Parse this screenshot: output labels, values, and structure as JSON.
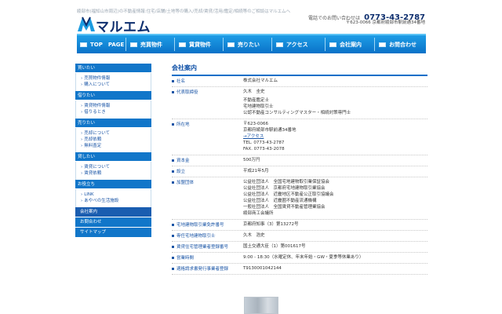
{
  "header": {
    "tagline": "綾部市(福知山市周辺)の不動産情報:住宅/店舗/土地等の購入/売却/賃貸/活用/鑑定/相続等のご相談はマルエムへ",
    "logo_text": "マルエム",
    "contact_label": "電話でのお問い合わせは",
    "phone": "0773-43-2787",
    "address": "〒623-0066 京都府綾部市駅前通34番地"
  },
  "global_nav": [
    {
      "label": "TOP　PAGE"
    },
    {
      "label": "売買物件"
    },
    {
      "label": "賃貸物件"
    },
    {
      "label": "売りたい"
    },
    {
      "label": "アクセス"
    },
    {
      "label": "会社案内"
    },
    {
      "label": "お問合わせ"
    }
  ],
  "side_nav": {
    "buy": {
      "title": "買いたい",
      "links": [
        "売買物件情報",
        "購入について"
      ]
    },
    "borrow": {
      "title": "借りたい",
      "links": [
        "賃貸物件情報",
        "借りるとき"
      ]
    },
    "sell": {
      "title": "売りたい",
      "links": [
        "売却について",
        "売却依頼",
        "無料査定"
      ]
    },
    "lend": {
      "title": "貸したい",
      "links": [
        "賃貸について",
        "賃貸依頼"
      ]
    },
    "useful": {
      "title": "お役立ち",
      "links": [
        "LINK",
        "あやべの生活施設"
      ]
    },
    "company": "会社案内",
    "contact": "お問合わせ",
    "sitemap": "サイトマップ"
  },
  "main": {
    "title": "会社案内",
    "rows": [
      {
        "key": "社名",
        "lines": [
          "株式会社マルエム"
        ]
      },
      {
        "key": "代表取締役",
        "lines": [
          "久木　圭史",
          "不動産鑑定士",
          "宅地建物取引士",
          "公認不動産コンサルティングマスター・相続対策専門士"
        ]
      },
      {
        "key": "所在地",
        "lines": [
          "〒623-0066",
          "京都府綾部市駅前通34番地",
          "→アクセス",
          "TEL. 0773-43-2787",
          "FAX. 0773-43-2078"
        ]
      },
      {
        "key": "資本金",
        "lines": [
          "500万円"
        ]
      },
      {
        "key": "設立",
        "lines": [
          "平成21年5月"
        ]
      },
      {
        "key": "加盟団体",
        "lines": [
          "公益社団法人　全国宅地建物取引業保証協会",
          "公益社団法人　京都府宅地建物取引業協会",
          "公益社団法人　近畿地区不動産公正取引協議会",
          "公益社団法人　近畿圏不動産流通機構",
          "一般社団法人　全国賃貸不動産管理業協会",
          "綾部商工会議所"
        ]
      },
      {
        "key": "宅地建物取引業免許番号",
        "lines": [
          "京都府知事（3）第13272号"
        ]
      },
      {
        "key": "専任宅地建物取引士",
        "lines": [
          "久木　浩史"
        ]
      },
      {
        "key": "賃貸住宅管理業者登録番号",
        "lines": [
          "国土交通大臣（1）第001617号"
        ]
      },
      {
        "key": "営業時間",
        "lines": [
          "9:00 - 18:30（水曜定休、年末年始・GW・夏季等休業あり）"
        ]
      },
      {
        "key": "適格請求書発行事業者登録",
        "lines": [
          "T9130001042144"
        ]
      }
    ]
  },
  "colors": {
    "nav_blue": "#1176c9",
    "brand_navy": "#0d2e6e",
    "link_blue": "#1a55a6"
  }
}
